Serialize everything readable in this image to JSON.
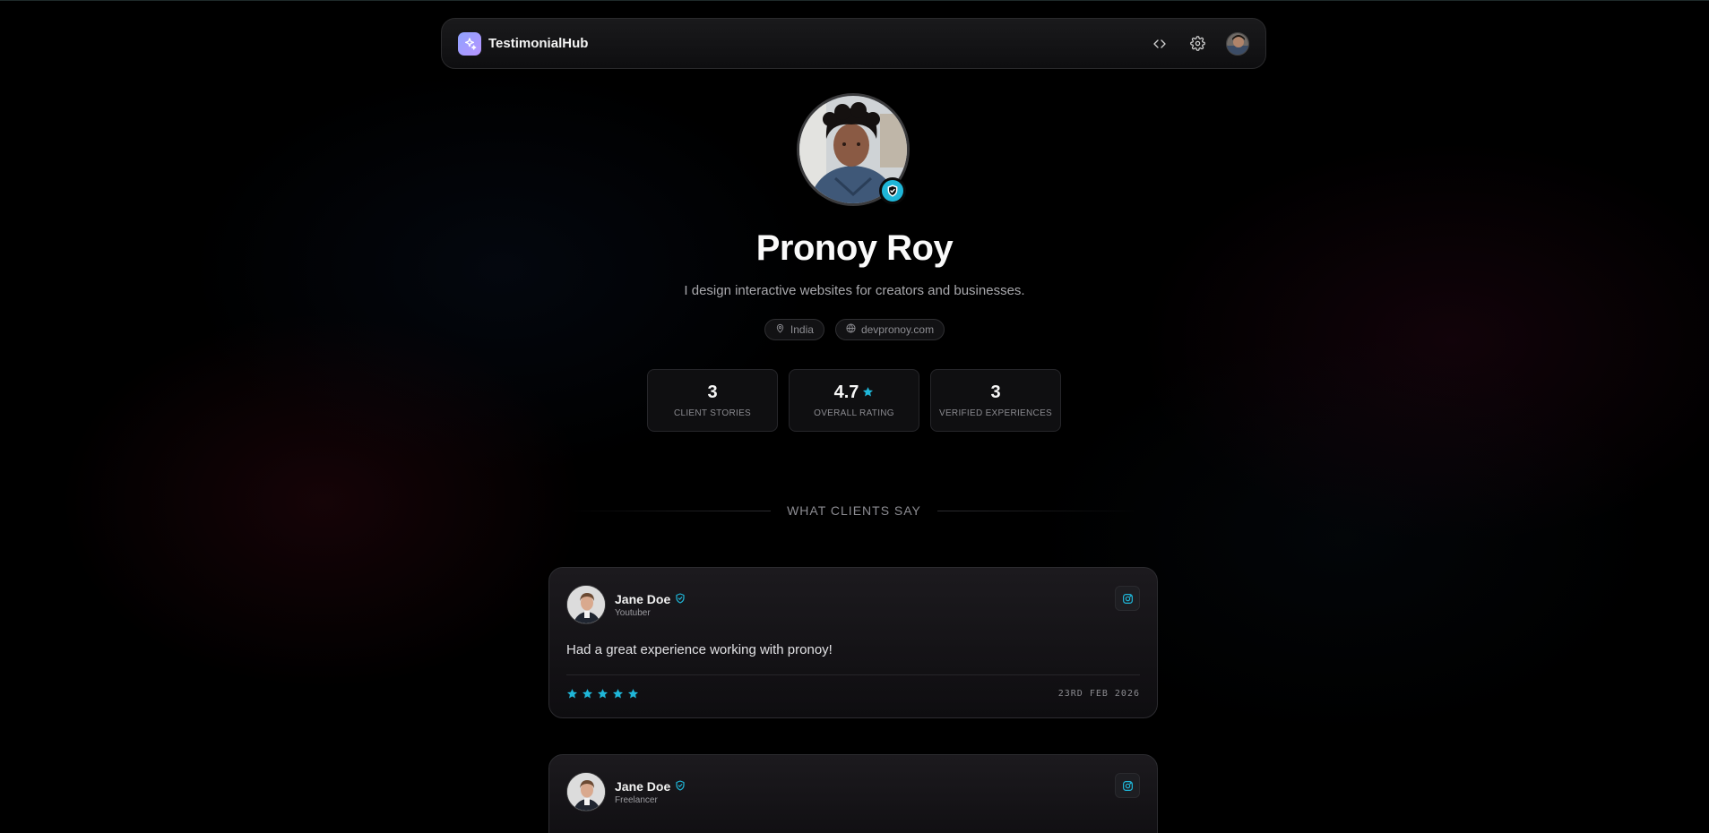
{
  "header": {
    "brand": "TestimonialHub",
    "icons": [
      "sparkles-icon",
      "code-icon",
      "gear-icon",
      "avatar"
    ]
  },
  "profile": {
    "name": "Pronoy Roy",
    "bio": "I design interactive websites for creators and businesses.",
    "location": "India",
    "website": "devpronoy.com",
    "verified": true
  },
  "stats": [
    {
      "value": "3",
      "label": "CLIENT STORIES"
    },
    {
      "value": "4.7",
      "label": "OVERALL RATING",
      "icon": "star-icon"
    },
    {
      "value": "3",
      "label": "VERIFIED EXPERIENCES"
    }
  ],
  "section": {
    "title": "WHAT CLIENTS SAY"
  },
  "testimonials": [
    {
      "name": "Jane Doe",
      "role": "Youtuber",
      "text": "Had a great experience working with pronoy!",
      "rating": 5,
      "date": "23RD FEB 2026",
      "source_icon": "instagram-icon"
    },
    {
      "name": "Jane Doe",
      "role": "Freelancer",
      "text": "",
      "source_icon": "instagram-icon"
    }
  ],
  "colors": {
    "accent": "#1fb6d8",
    "background": "#000000",
    "logo_gradient_start": "#8fa3ff",
    "logo_gradient_end": "#b694ff"
  }
}
